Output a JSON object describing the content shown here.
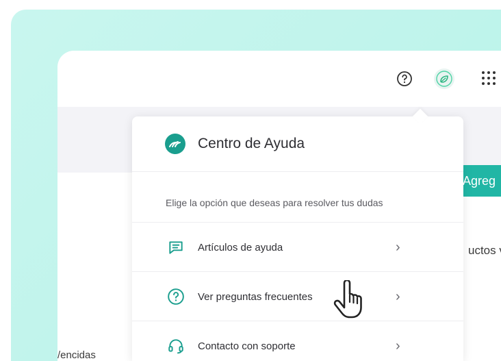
{
  "header": {
    "help_icon": "question-circle-icon",
    "profile_icon": "leaf-icon",
    "apps_icon": "grid-dots-icon"
  },
  "background": {
    "button_label": "Agreg",
    "right_text": "uctos v",
    "left_text": "/encidas"
  },
  "help_center": {
    "title": "Centro de Ayuda",
    "subtitle": "Elige la opción que deseas para resolver tus dudas",
    "items": [
      {
        "label": "Artículos de ayuda",
        "icon": "message-square-icon"
      },
      {
        "label": "Ver preguntas frecuentes",
        "icon": "question-circle-icon"
      },
      {
        "label": "Contacto con soporte",
        "icon": "headset-icon"
      }
    ]
  },
  "colors": {
    "accent": "#21b6a5",
    "brand": "#1a9e8e",
    "outer_bg": "#c4f5ed"
  }
}
